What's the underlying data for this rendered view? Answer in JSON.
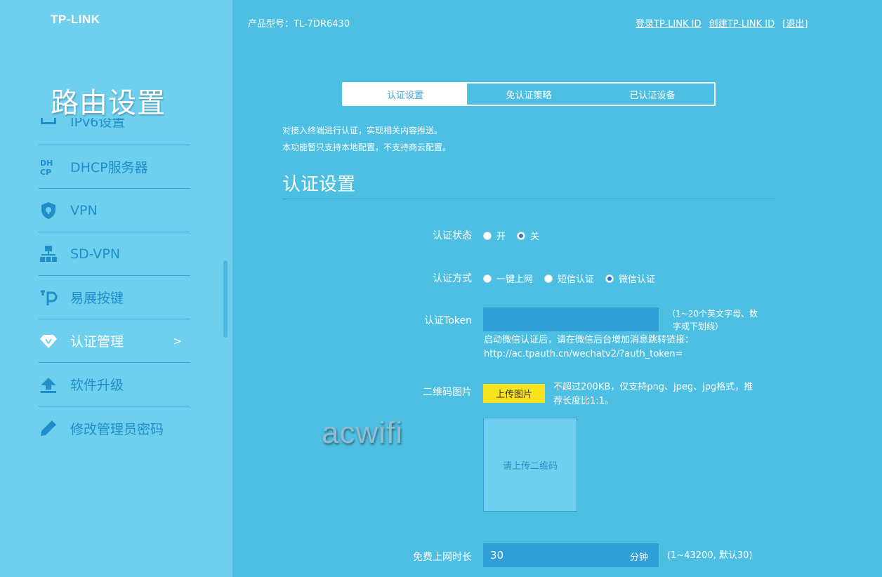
{
  "brand": {
    "logo": "TP-LINK"
  },
  "sidebar": {
    "title": "路由设置",
    "items": [
      {
        "label": "IPv6设置",
        "icon": "ipv6-icon"
      },
      {
        "label": "DHCP服务器",
        "icon": "dhcp-icon"
      },
      {
        "label": "VPN",
        "icon": "vpn-shield-icon"
      },
      {
        "label": "SD-VPN",
        "icon": "network-icon"
      },
      {
        "label": "易展按键",
        "icon": "easymesh-icon"
      },
      {
        "label": "认证管理",
        "icon": "diamond-icon",
        "arrow": ">"
      },
      {
        "label": "软件升级",
        "icon": "upload-icon"
      },
      {
        "label": "修改管理员密码",
        "icon": "pencil-icon"
      }
    ]
  },
  "header": {
    "model_label": "产品型号：",
    "model_value": "TL-7DR6430",
    "link_login": "登录TP-LINK ID",
    "link_create": "创建TP-LINK ID",
    "link_logout": "[退出]"
  },
  "tabs": [
    "认证设置",
    "免认证策略",
    "已认证设备"
  ],
  "desc": {
    "line1": "对接入终端进行认证，实现相关内容推送。",
    "line2": "本功能暂只支持本地配置，不支持商云配置。"
  },
  "section": {
    "title": "认证设置"
  },
  "form": {
    "status": {
      "label": "认证状态",
      "options": [
        "开",
        "关"
      ],
      "selected": "关"
    },
    "method": {
      "label": "认证方式",
      "options": [
        "一键上网",
        "短信认证",
        "微信认证"
      ],
      "selected": "微信认证"
    },
    "token": {
      "label": "认证Token",
      "value": "",
      "hint1": "（1~20个英文字母、数",
      "hint2": "字或下划线）",
      "note1": "启动微信认证后，请在微信后台增加消息跳转链接：",
      "note2": "http://ac.tpauth.cn/wechatv2/?auth_token="
    },
    "qrcode": {
      "label": "二维码图片",
      "button": "上传图片",
      "hint1": "不超过200KB，仅支持png、jpeg、jpg格式，推",
      "hint2": "荐长度比1:1。",
      "placeholder": "请上传二维码"
    },
    "free_time": {
      "label": "免费上网时长",
      "value": "30",
      "unit": "分钟",
      "hint": "(1~43200, 默认30)"
    }
  },
  "watermark": "acwifi",
  "colors": {
    "background": "#4dbfe3",
    "sidebar": "#6fcfee",
    "accent_yellow": "#f7e21b",
    "input": "#2f9fd6"
  }
}
